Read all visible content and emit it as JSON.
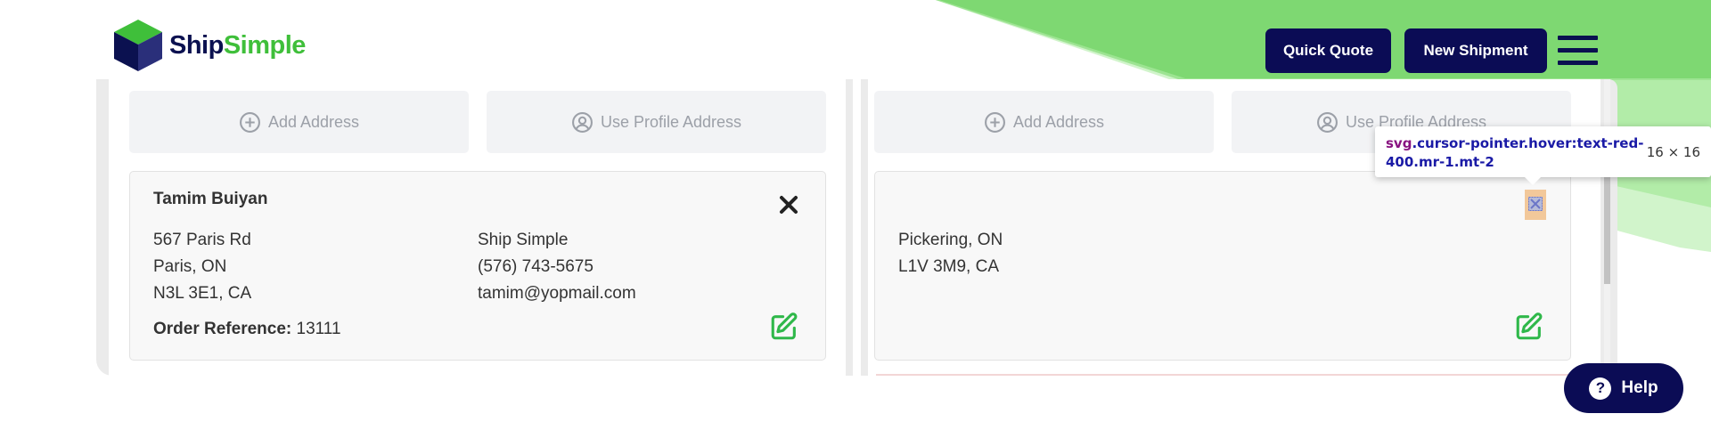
{
  "brand": {
    "logo_part1": "Ship",
    "logo_part2": "Simple"
  },
  "header": {
    "quick_quote_label": "Quick Quote",
    "new_shipment_label": "New Shipment"
  },
  "sender": {
    "add_address_label": "Add Address",
    "use_profile_label": "Use Profile Address",
    "name": "Tamim Buiyan",
    "street": "567 Paris Rd",
    "city_line": "Paris, ON",
    "postal_line": "N3L 3E1, CA",
    "company": "Ship Simple",
    "phone": "(576) 743-5675",
    "email": "tamim@yopmail.com",
    "order_reference_label": "Order Reference:",
    "order_reference_value": "13111"
  },
  "recipient": {
    "add_address_label": "Add Address",
    "use_profile_label": "Use Profile Address",
    "city_line": "Pickering, ON",
    "postal_line": "L1V 3M9, CA"
  },
  "devtools_tooltip": {
    "tag": "svg",
    "selector": ".cursor-pointer.hover:text-red-400.mr-1.mt-2",
    "dimensions": "16 × 16"
  },
  "help": {
    "label": "Help",
    "icon_char": "?"
  },
  "colors": {
    "navy": "#0b0c55",
    "brand_green": "#3fbf3a",
    "bg_green": "#7ed872",
    "bg_green_light": "#b2eca9",
    "edit_green": "#2fb84a"
  },
  "icons": {
    "add_address": "plus-circle-icon",
    "use_profile": "user-circle-icon",
    "close": "close-icon",
    "edit": "edit-icon",
    "menu": "hamburger-icon"
  }
}
